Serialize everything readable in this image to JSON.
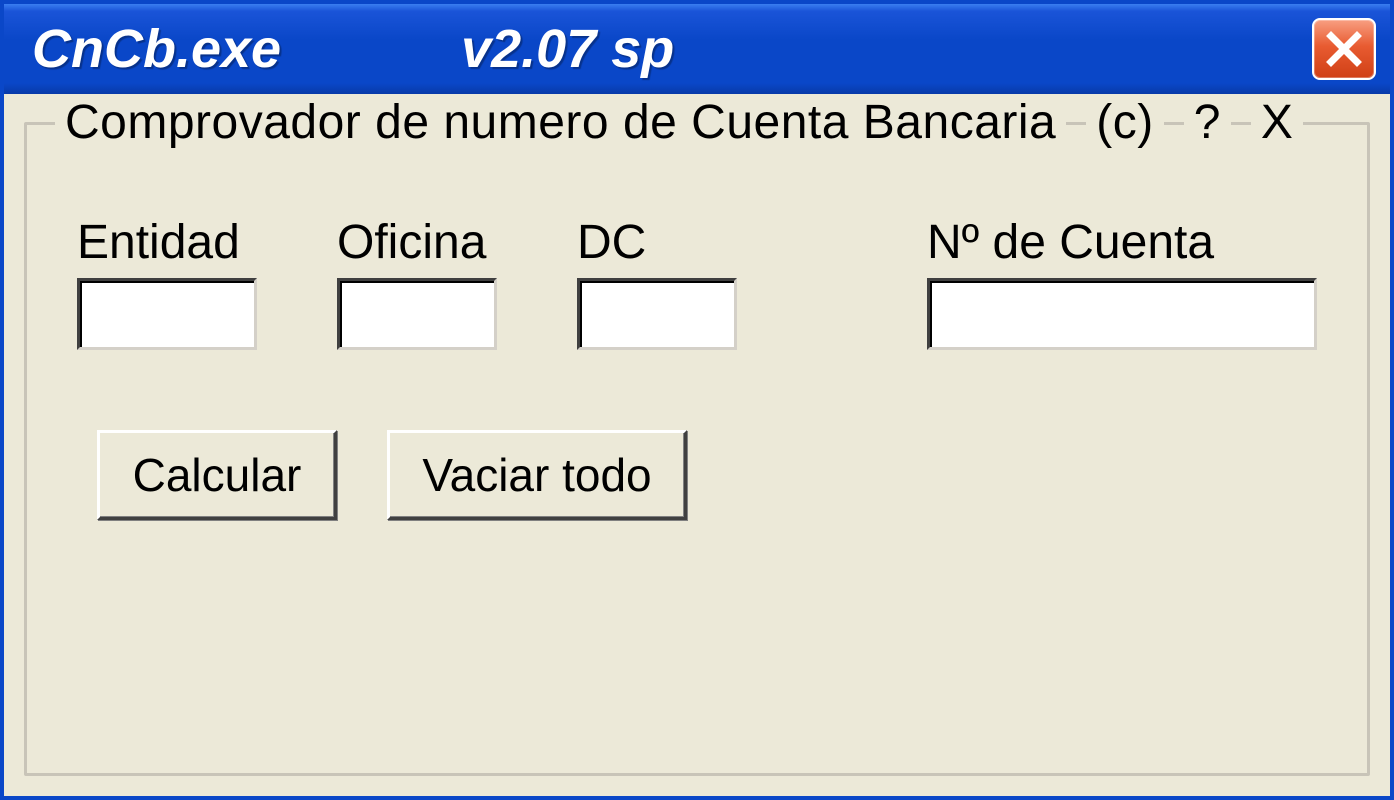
{
  "titlebar": {
    "app_name": "CnCb.exe",
    "version": "v2.07  sp"
  },
  "group": {
    "title": "Comprovador de numero de Cuenta Bancaria",
    "copyright": "(c)",
    "help": "?",
    "close": "X"
  },
  "fields": {
    "entidad": {
      "label": "Entidad",
      "value": ""
    },
    "oficina": {
      "label": "Oficina",
      "value": ""
    },
    "dc": {
      "label": "DC",
      "value": ""
    },
    "cuenta": {
      "label": "Nº de Cuenta",
      "value": ""
    }
  },
  "buttons": {
    "calcular": "Calcular",
    "vaciar": "Vaciar todo"
  }
}
